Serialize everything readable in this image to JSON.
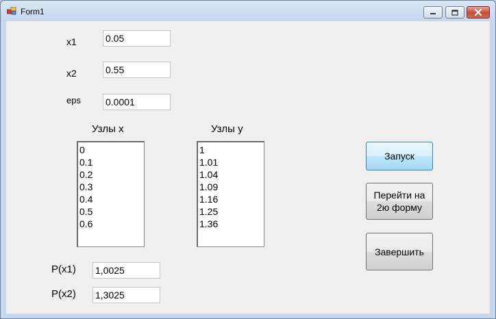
{
  "window": {
    "title": "Form1"
  },
  "fields": {
    "x1": {
      "label": "x1",
      "value": "0.05"
    },
    "x2": {
      "label": "x2",
      "value": "0.55"
    },
    "eps": {
      "label": "eps",
      "value": "0.0001"
    }
  },
  "lists": {
    "nodes_x": {
      "label": "Узлы x",
      "items": [
        "0",
        "0.1",
        "0.2",
        "0.3",
        "0.4",
        "0.5",
        "0.6"
      ]
    },
    "nodes_y": {
      "label": "Узлы y",
      "items": [
        "1",
        "1.01",
        "1.04",
        "1.09",
        "1.16",
        "1.25",
        "1.36"
      ]
    }
  },
  "results": {
    "p_x1": {
      "label": "P(x1)",
      "value": "1,0025"
    },
    "p_x2": {
      "label": "P(x2)",
      "value": "1,3025"
    }
  },
  "buttons": {
    "run": "Запуск",
    "form2": "Перейти на 2ю форму",
    "finish": "Завершить"
  }
}
